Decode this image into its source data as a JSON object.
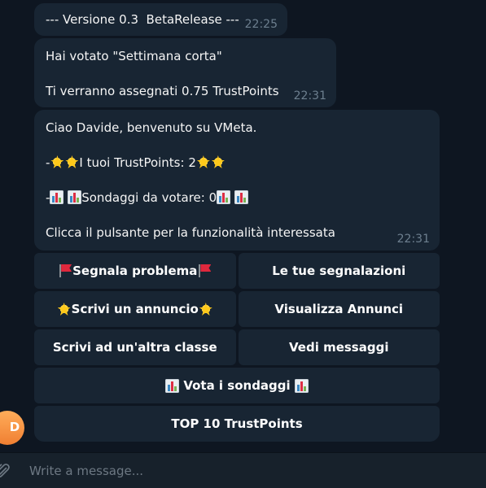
{
  "messages": [
    {
      "lines": [
        "--- Versione 0.3  BetaRelease ---"
      ],
      "time": "22:25"
    },
    {
      "lines": [
        "Hai votato \"Settimana corta\"",
        "Ti verranno assegnati 0.75 TrustPoints"
      ],
      "time": "22:31"
    },
    {
      "greeting": "Ciao Davide, benvenuto su VMeta.",
      "trust_prefix": "-",
      "trust_label": "I tuoi TrustPoints: 2",
      "polls_prefix": "-",
      "polls_label": "Sondaggi da votare: 0",
      "cta": "Clicca il pulsante per la funzionalità interessata",
      "time": "22:31"
    }
  ],
  "keyboard": {
    "report_problem": "Segnala problema",
    "your_reports": "Le tue segnalazioni",
    "write_ad": "Scrivi un annuncio",
    "view_ads": "Visualizza Annunci",
    "write_other_class": "Scrivi ad un'altra classe",
    "view_messages": "Vedi messaggi",
    "vote_polls": "Vota i sondaggi",
    "top10": "TOP 10 TrustPoints"
  },
  "avatar_letter": "D",
  "composer": {
    "placeholder": "Write a message..."
  },
  "icons": {
    "star": "glowing-star-icon",
    "chart": "bar-chart-icon",
    "flag": "red-flag-icon",
    "attach": "paperclip-icon"
  },
  "colors": {
    "background": "#0e1621",
    "bubble": "#182533",
    "timestamp": "#6d7f8f",
    "avatar": "#f07f32"
  }
}
